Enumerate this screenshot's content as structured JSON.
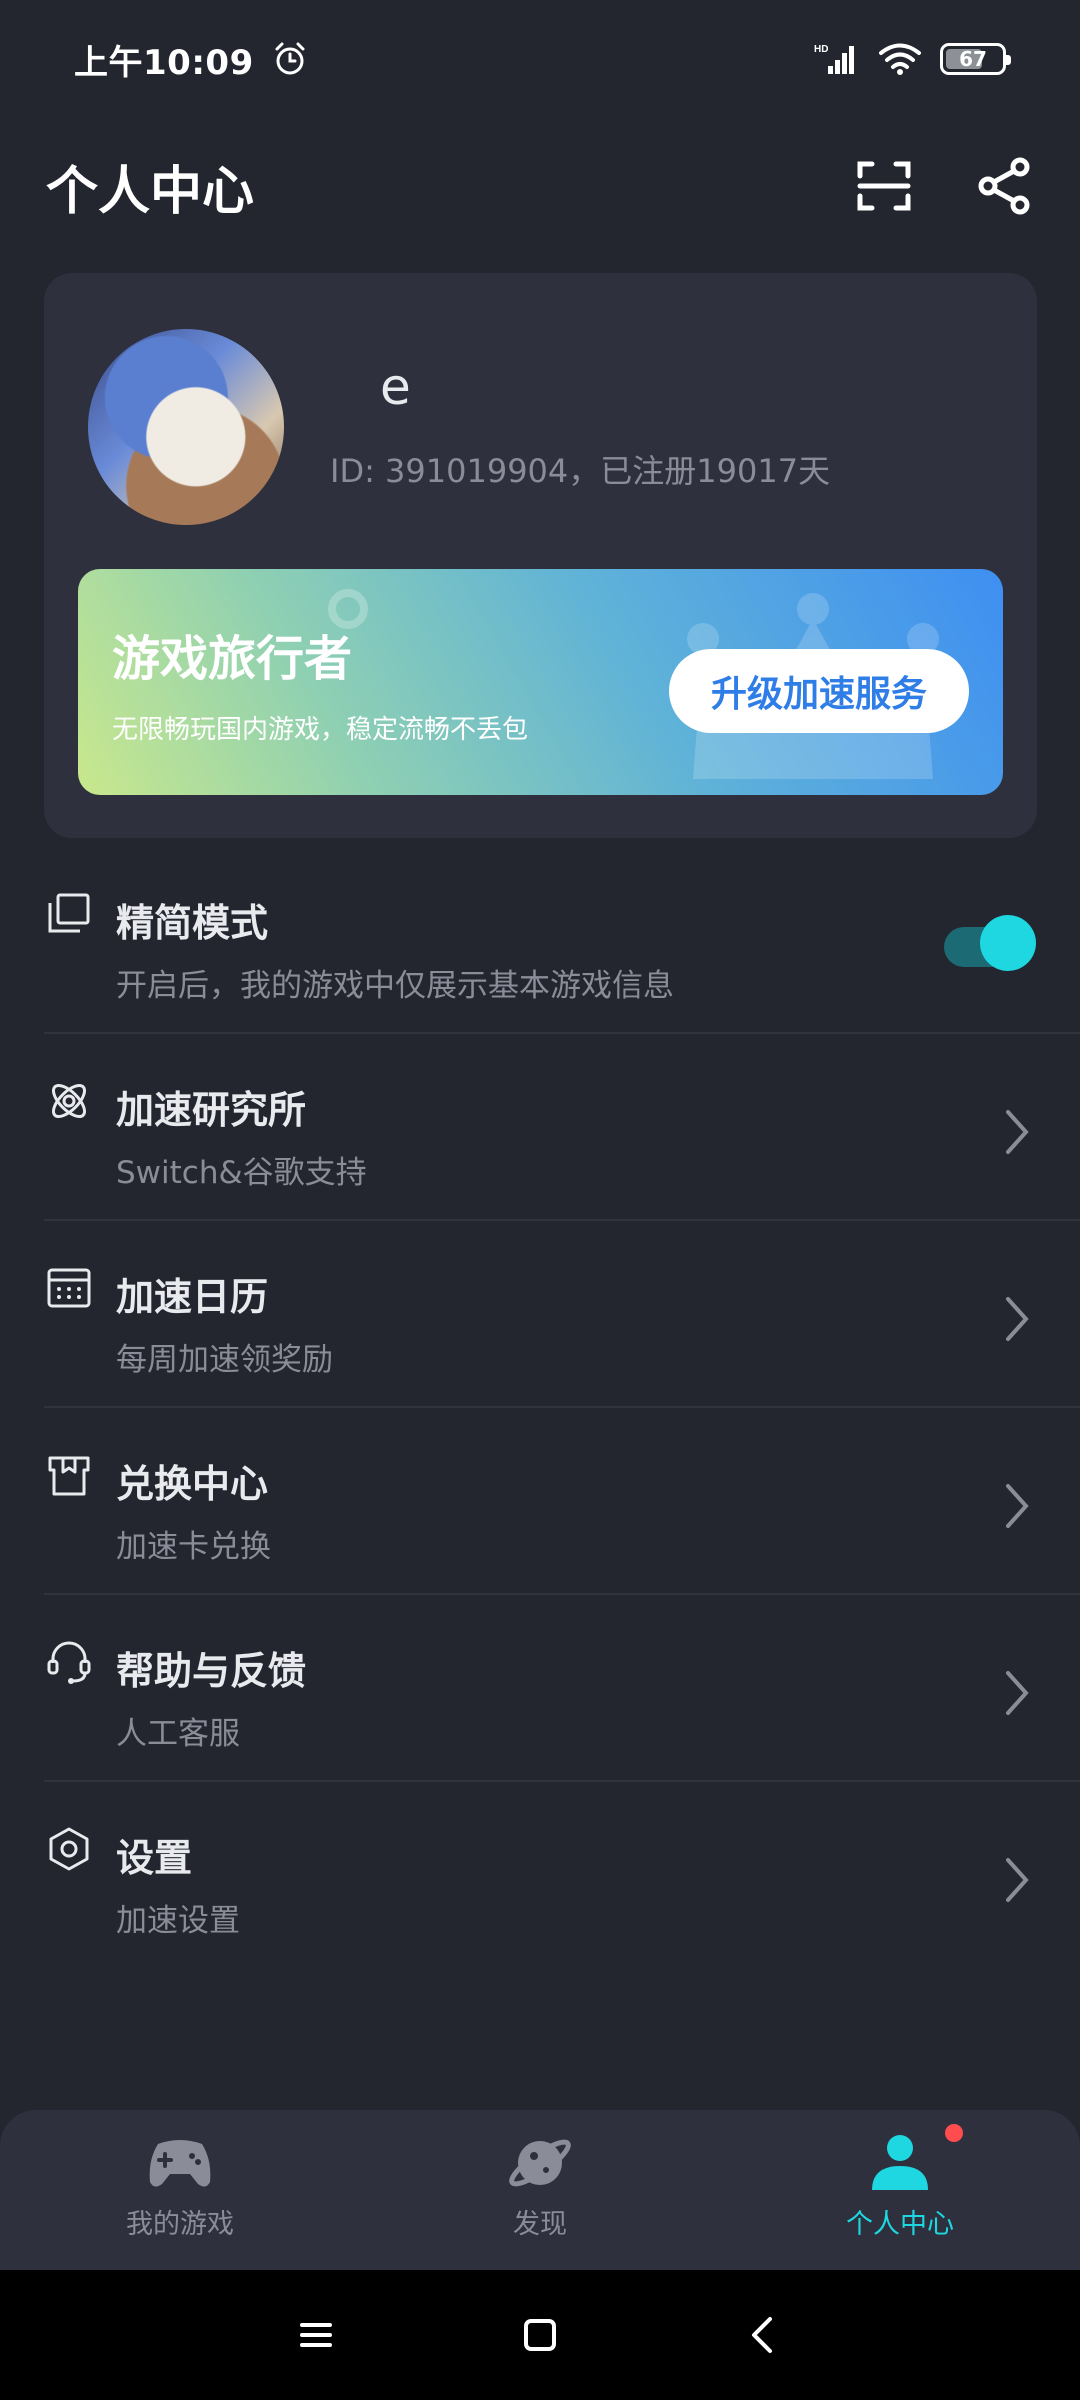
{
  "status_bar": {
    "time": "上午10:09",
    "network_label": "HD",
    "battery": "67"
  },
  "header": {
    "title": "个人中心"
  },
  "profile": {
    "username": "e",
    "id_text": "ID: 391019904，已注册19017天"
  },
  "vip": {
    "title": "游戏旅行者",
    "subtitle": "无限畅玩国内游戏，稳定流畅不丢包",
    "button_label": "升级加速服务"
  },
  "menu": {
    "items": [
      {
        "title": "精简模式",
        "subtitle": "开启后，我的游戏中仅展示基本游戏信息",
        "icon": "layers-icon",
        "toggle_on": true
      },
      {
        "title": "加速研究所",
        "subtitle": "Switch&谷歌支持",
        "icon": "atom-icon"
      },
      {
        "title": "加速日历",
        "subtitle": "每周加速领奖励",
        "icon": "calendar-icon"
      },
      {
        "title": "兑换中心",
        "subtitle": "加速卡兑换",
        "icon": "gift-icon"
      },
      {
        "title": "帮助与反馈",
        "subtitle": "人工客服",
        "icon": "headset-icon"
      },
      {
        "title": "设置",
        "subtitle": "加速设置",
        "icon": "hex-settings-icon"
      }
    ]
  },
  "bottom_nav": {
    "items": [
      {
        "label": "我的游戏",
        "icon": "gamepad-icon"
      },
      {
        "label": "发现",
        "icon": "planet-icon"
      },
      {
        "label": "个人中心",
        "icon": "person-icon",
        "active": true
      }
    ]
  },
  "colors": {
    "background": "#23252f",
    "card": "#2e313d",
    "accent": "#1ed7e1",
    "vip_button_text": "#2f7de6"
  }
}
